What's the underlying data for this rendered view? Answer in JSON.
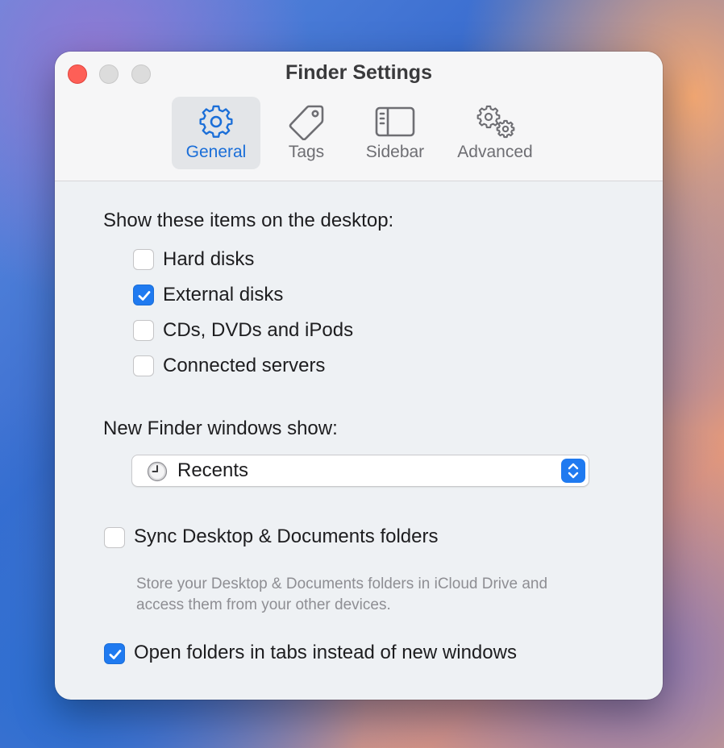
{
  "window": {
    "title": "Finder Settings"
  },
  "tabs": [
    {
      "label": "General",
      "icon": "gear-icon",
      "selected": true
    },
    {
      "label": "Tags",
      "icon": "tag-icon",
      "selected": false
    },
    {
      "label": "Sidebar",
      "icon": "sidebar-icon",
      "selected": false
    },
    {
      "label": "Advanced",
      "icon": "gears-icon",
      "selected": false
    }
  ],
  "desktop_items": {
    "heading": "Show these items on the desktop:",
    "items": [
      {
        "label": "Hard disks",
        "checked": false
      },
      {
        "label": "External disks",
        "checked": true
      },
      {
        "label": "CDs, DVDs and iPods",
        "checked": false
      },
      {
        "label": "Connected servers",
        "checked": false
      }
    ]
  },
  "new_windows": {
    "heading": "New Finder windows show:",
    "selected": "Recents",
    "selected_icon": "clock-icon"
  },
  "sync": {
    "label": "Sync Desktop & Documents folders",
    "checked": false,
    "description": "Store your Desktop & Documents folders in iCloud Drive and access them from your other devices."
  },
  "tabs_option": {
    "label": "Open folders in tabs instead of new windows",
    "checked": true
  },
  "colors": {
    "accent": "#1f7af0",
    "close": "#fe5f57"
  }
}
